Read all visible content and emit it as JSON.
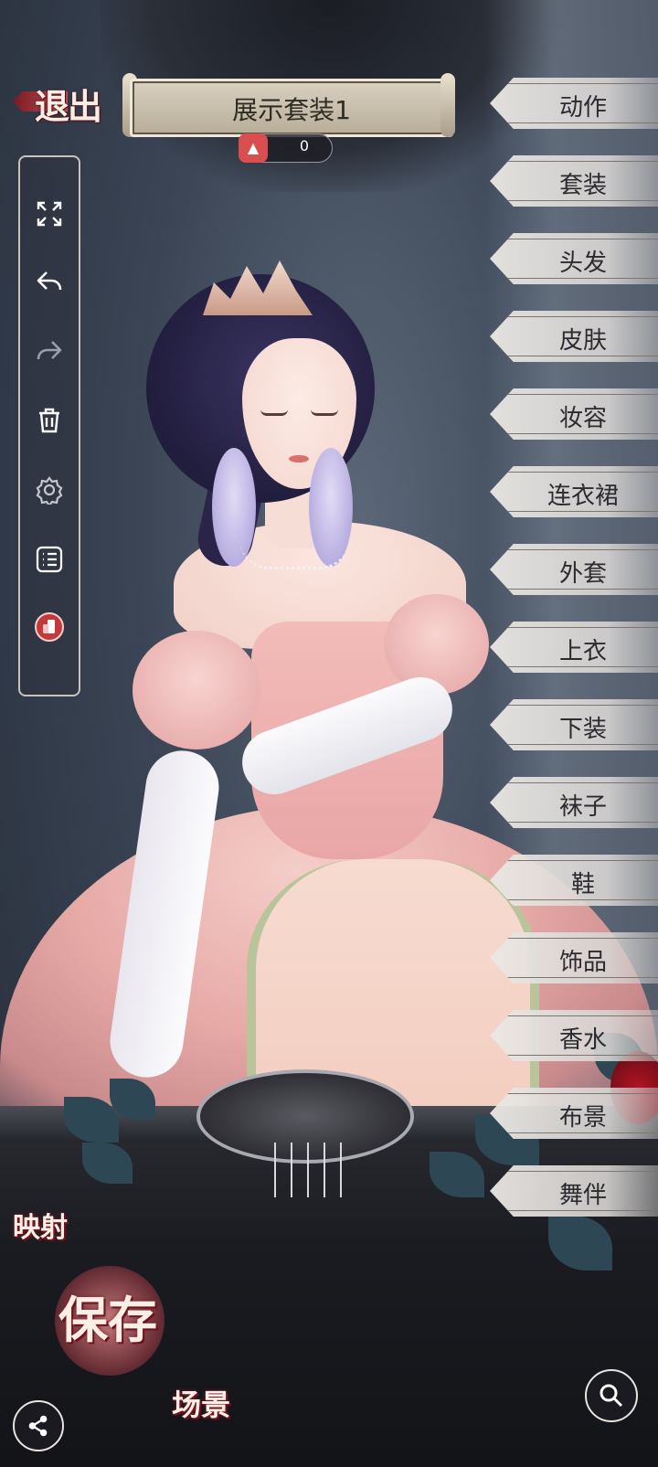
{
  "header": {
    "exit_label": "退出",
    "title": "展示套装1",
    "like_count": "0"
  },
  "toolbar": {
    "items": [
      "expand-icon",
      "undo-icon",
      "redo-icon",
      "trash-icon",
      "gear-icon",
      "list-icon",
      "wardrobe-icon"
    ]
  },
  "categories": [
    "动作",
    "套装",
    "头发",
    "皮肤",
    "妆容",
    "连衣裙",
    "外套",
    "上衣",
    "下装",
    "袜子",
    "鞋",
    "饰品",
    "香水",
    "布景",
    "舞伴"
  ],
  "bottom": {
    "mirror_label": "映射",
    "save_label": "保存",
    "scene_label": "场景"
  },
  "colors": {
    "accent_red": "#c2525a",
    "dress_pink": "#e7a9a6",
    "hair_purple": "#2a2548"
  }
}
